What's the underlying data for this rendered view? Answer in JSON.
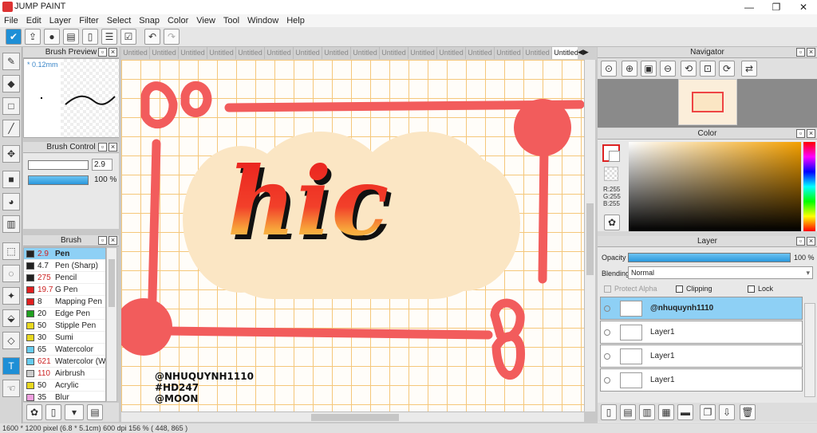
{
  "window": {
    "title": "JUMP PAINT",
    "minimize": "—",
    "maximize": "❐",
    "close": "✕"
  },
  "menu": [
    "File",
    "Edit",
    "Layer",
    "Filter",
    "Select",
    "Snap",
    "Color",
    "View",
    "Tool",
    "Window",
    "Help"
  ],
  "toolbar": {
    "icons": [
      "check-icon",
      "export-icon",
      "comment-icon",
      "message-icon",
      "page-icon",
      "list-icon",
      "checklist-icon"
    ],
    "undo_glyph": "↶",
    "redo_glyph": "↷"
  },
  "brush_preview": {
    "title": "Brush Preview",
    "size": "* 0.12mm"
  },
  "brush_control": {
    "title": "Brush Control",
    "size_value": "2.9",
    "opacity_value": "100 %",
    "opacity_fill": 1.0
  },
  "brush": {
    "title": "Brush",
    "items": [
      {
        "size": "2.9",
        "name": "Pen",
        "color": "#222222",
        "size_color": "#cc2222",
        "selected": true
      },
      {
        "size": "4.7",
        "name": "Pen (Sharp)",
        "color": "#222222",
        "size_color": "#222222"
      },
      {
        "size": "275",
        "name": "Pencil",
        "color": "#222222",
        "size_color": "#cc2222"
      },
      {
        "size": "19.7",
        "name": "G Pen",
        "color": "#e02020",
        "size_color": "#cc2222"
      },
      {
        "size": "8",
        "name": "Mapping Pen",
        "color": "#e02020",
        "size_color": "#222222"
      },
      {
        "size": "20",
        "name": "Edge Pen",
        "color": "#20a020",
        "size_color": "#222222"
      },
      {
        "size": "50",
        "name": "Stipple Pen",
        "color": "#e8d820",
        "size_color": "#222222"
      },
      {
        "size": "30",
        "name": "Sumi",
        "color": "#e8d820",
        "size_color": "#222222"
      },
      {
        "size": "65",
        "name": "Watercolor",
        "color": "#66ccf0",
        "size_color": "#222222"
      },
      {
        "size": "621",
        "name": "Watercolor (We",
        "color": "#66ccf0",
        "size_color": "#cc2222"
      },
      {
        "size": "110",
        "name": "Airbrush",
        "color": "#cccccc",
        "size_color": "#cc2222"
      },
      {
        "size": "50",
        "name": "Acrylic",
        "color": "#e8d820",
        "size_color": "#222222"
      },
      {
        "size": "35",
        "name": "Blur",
        "color": "#f0a0e0",
        "size_color": "#222222"
      }
    ]
  },
  "tabs": [
    "Untitled",
    "Untitled",
    "Untitled",
    "Untitled",
    "Untitled",
    "Untitled",
    "Untitled",
    "Untitled",
    "Untitled",
    "Untitled",
    "Untitled",
    "Untitled",
    "Untitled",
    "Untitled",
    "Untitled",
    "Untitled"
  ],
  "canvas": {
    "watermark": [
      "@NHUQUYNH1110",
      "#HD247",
      "@MOON"
    ],
    "text": "hic",
    "colors": {
      "frame": "#f25c5c",
      "blob": "#fbe6c4",
      "grid": "#f5c77a"
    }
  },
  "navigator": {
    "title": "Navigator"
  },
  "color_panel": {
    "title": "Color",
    "r": "R:255",
    "g": "G:255",
    "b": "B:255"
  },
  "layer_panel": {
    "title": "Layer",
    "opacity_label": "Opacity",
    "opacity_value": "100 %",
    "opacity_fill": 1.0,
    "blending_label": "Blending",
    "blending_value": "Normal",
    "protect_alpha": "Protect Alpha",
    "clipping": "Clipping",
    "lock": "Lock",
    "layers": [
      {
        "name": "@nhuquynh1110",
        "selected": true
      },
      {
        "name": "Layer1"
      },
      {
        "name": "Layer1"
      },
      {
        "name": "Layer1"
      }
    ]
  },
  "status": "1600 * 1200 pixel   (6.8 * 5.1cm)   600 dpi   156 %   ( 448, 865 )"
}
